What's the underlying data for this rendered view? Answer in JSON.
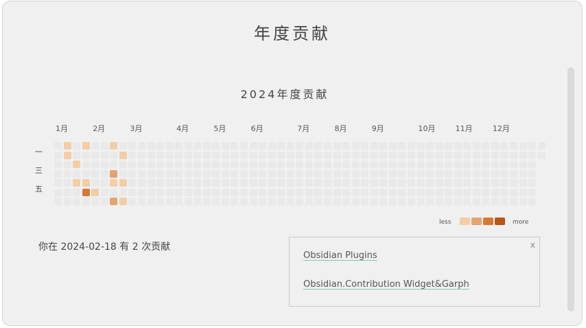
{
  "modal": {
    "title": "年度贡献"
  },
  "heatmap": {
    "title": "2024年度贡献",
    "months": [
      "1月",
      "2月",
      "3月",
      "4月",
      "5月",
      "6月",
      "7月",
      "8月",
      "9月",
      "10月",
      "11月",
      "12月"
    ],
    "weekdays": [
      "一",
      "三",
      "五"
    ],
    "legend_less": "less",
    "legend_more": "more"
  },
  "colors": {
    "empty": "#e9e9e9",
    "level1": "#f3cda7",
    "level2": "#e3a373",
    "level3": "#d57a36",
    "level4": "#b5561a"
  },
  "chart_data": {
    "type": "heatmap",
    "year": 2024,
    "contributions": [
      {
        "date": "2024-01-08",
        "count": 1
      },
      {
        "date": "2024-01-09",
        "count": 1
      },
      {
        "date": "2024-01-17",
        "count": 1
      },
      {
        "date": "2024-01-19",
        "count": 1
      },
      {
        "date": "2024-01-22",
        "count": 1
      },
      {
        "date": "2024-01-26",
        "count": 1
      },
      {
        "date": "2024-01-27",
        "count": 3
      },
      {
        "date": "2024-02-03",
        "count": 1
      },
      {
        "date": "2024-02-12",
        "count": 1
      },
      {
        "date": "2024-02-15",
        "count": 2
      },
      {
        "date": "2024-02-16",
        "count": 1
      },
      {
        "date": "2024-02-18",
        "count": 2
      },
      {
        "date": "2024-02-20",
        "count": 1
      },
      {
        "date": "2024-02-23",
        "count": 1
      },
      {
        "date": "2024-02-25",
        "count": 1
      }
    ]
  },
  "status": {
    "text": "你在 2024-02-18 有 2 次贡献"
  },
  "links": {
    "close_label": "x",
    "items": [
      "Obsidian Plugins",
      "Obsidian.Contribution Widget&Garph"
    ]
  }
}
